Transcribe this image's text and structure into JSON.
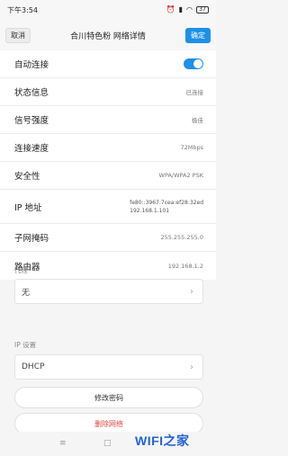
{
  "status_bar": {
    "time": "下午3:54",
    "battery": "37"
  },
  "action_bar": {
    "cancel_label": "取消",
    "title": "合川特色粉  网络详情",
    "ok_label": "确定"
  },
  "rows": {
    "auto_connect": {
      "label": "自动连接"
    },
    "status": {
      "label": "状态信息",
      "value": "已连接"
    },
    "signal": {
      "label": "信号强度",
      "value": "极佳"
    },
    "speed": {
      "label": "连接速度",
      "value": "72Mbps"
    },
    "security": {
      "label": "安全性",
      "value": "WPA/WPA2 PSK"
    },
    "ip": {
      "label": "IP 地址",
      "value_v6": "fe80::3967:7cea:ef28:32ed",
      "value_v4": "192.168.1.101"
    },
    "subnet": {
      "label": "子网掩码",
      "value": "255.255.255.0"
    },
    "router": {
      "label": "路由器",
      "value": "192.168.1.2"
    }
  },
  "proxy": {
    "label": "代理",
    "value": "无"
  },
  "ip_settings": {
    "label": "IP 设置",
    "value": "DHCP"
  },
  "buttons": {
    "change_password": "修改密码",
    "delete_network": "删除网络"
  },
  "watermark": "WIFI之家"
}
